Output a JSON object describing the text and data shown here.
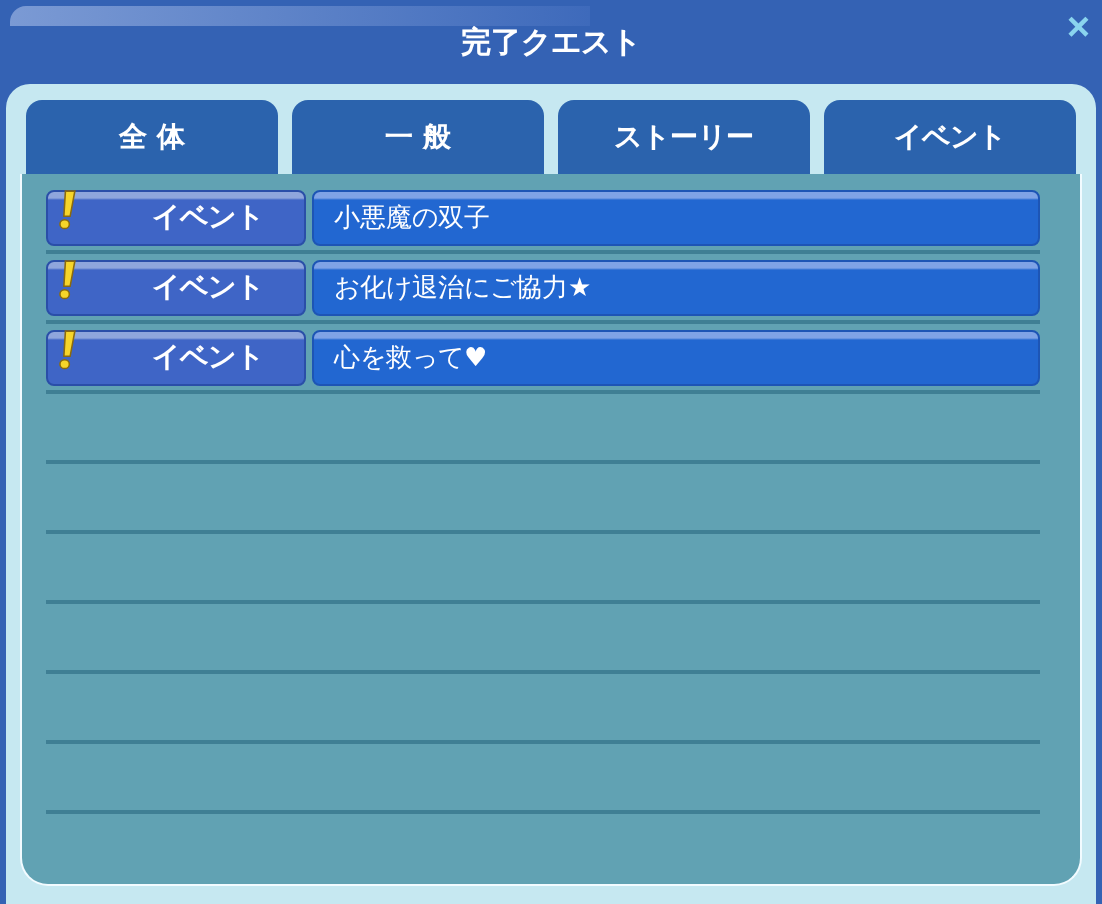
{
  "window": {
    "title": "完了クエスト",
    "close": "×"
  },
  "tabs": [
    {
      "label": "全 体",
      "selected": false
    },
    {
      "label": "一 般",
      "selected": false
    },
    {
      "label": "ストーリー",
      "selected": false
    },
    {
      "label": "イベント",
      "selected": false
    }
  ],
  "quests": [
    {
      "category": "イベント",
      "title": "小悪魔の双子"
    },
    {
      "category": "イベント",
      "title": "お化け退治にご協力★"
    },
    {
      "category": "イベント",
      "title": "心を救って♥"
    }
  ]
}
